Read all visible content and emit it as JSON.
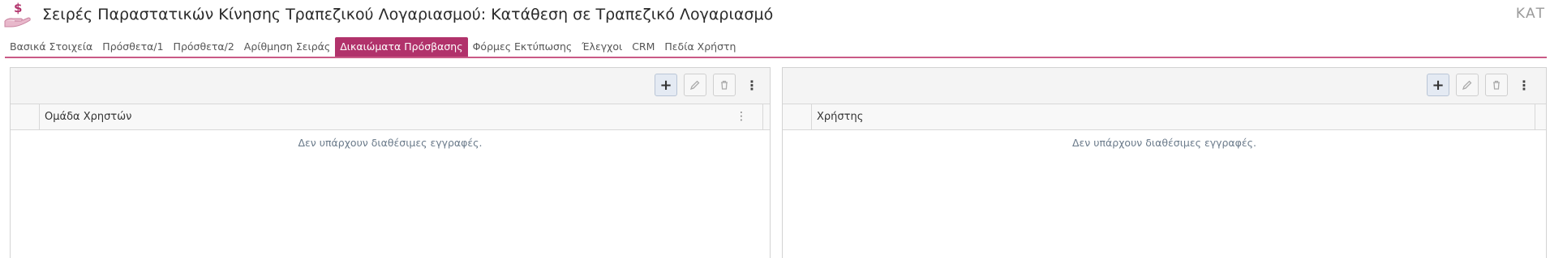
{
  "header": {
    "title": "Σειρές Παραστατικών Κίνησης Τραπεζικού Λογαριασμού: Κατάθεση σε Τραπεζικό Λογαριασμό",
    "code": "ΚΑΤ",
    "icon": "money-hand-icon",
    "icon_color": "#b1326b"
  },
  "tabs": [
    {
      "label": "Βασικά Στοιχεία"
    },
    {
      "label": "Πρόσθετα/1"
    },
    {
      "label": "Πρόσθετα/2"
    },
    {
      "label": "Αρίθμηση Σειράς"
    },
    {
      "label": "Δικαιώματα Πρόσβασης",
      "active": true
    },
    {
      "label": "Φόρμες Εκτύπωσης"
    },
    {
      "label": "Έλεγχοι"
    },
    {
      "label": "CRM"
    },
    {
      "label": "Πεδία Χρήστη"
    }
  ],
  "accent_color": "#b1326b",
  "left_panel": {
    "column": "Ομάδα Χρηστών",
    "empty_text": "Δεν υπάρχουν διαθέσιμες εγγραφές.",
    "toolbar": {
      "add": "+",
      "edit_icon": "pencil-icon",
      "delete_icon": "trash-icon",
      "more": "⋮"
    }
  },
  "right_panel": {
    "column": "Χρήστης",
    "empty_text": "Δεν υπάρχουν διαθέσιμες εγγραφές.",
    "toolbar": {
      "add": "+",
      "edit_icon": "pencil-icon",
      "delete_icon": "trash-icon",
      "more": "⋮"
    }
  }
}
